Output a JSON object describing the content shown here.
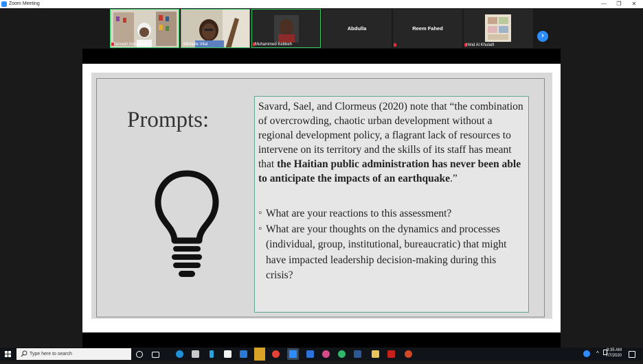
{
  "window": {
    "title": "Zoom Meeting"
  },
  "window_controls": {
    "minimize": "—",
    "restore": "❐",
    "close": "✕"
  },
  "participants": [
    {
      "name": "Tanrash Amanshan",
      "muted": true,
      "has_video": true
    },
    {
      "name": "Michelle Vital",
      "muted": false,
      "has_video": true
    },
    {
      "name": "Muhammed Kebbeh",
      "muted": true,
      "has_video": true
    },
    {
      "name": "Abdulla",
      "muted": false,
      "has_video": false
    },
    {
      "name": "Reem Fahed",
      "muted": true,
      "has_video": false
    },
    {
      "name": "Hind Al Khulaifi",
      "muted": true,
      "has_video": true
    }
  ],
  "gallery": {
    "next_icon": "chevron-right-icon",
    "next_glyph": "›"
  },
  "slide": {
    "heading": "Prompts:",
    "quote_plain": "Savard, Sael, and Clormeus (2020) note that “the combination of overcrowding, chaotic urban development without a regional development policy, a flagrant lack of resources to intervene on its territory and the skills of its staff has meant that ",
    "quote_bold": "the Haitian public administration has never been able to anticipate the impacts of an earthquake",
    "quote_end": ".”",
    "bullets": [
      "What are your reactions to this assessment?",
      "What are your thoughts on the dynamics and processes (individual, group, institutional, bureaucratic) that might have impacted leadership decision-making during this crisis?"
    ]
  },
  "taskbar": {
    "search_placeholder": "Type here to search",
    "time": "9:35 AM",
    "date": "7/7/2020",
    "tray_up": "^"
  },
  "colors": {
    "zoom_blue": "#2d8cff",
    "muted_red": "#e0303b",
    "slide_border": "#5fa896"
  }
}
